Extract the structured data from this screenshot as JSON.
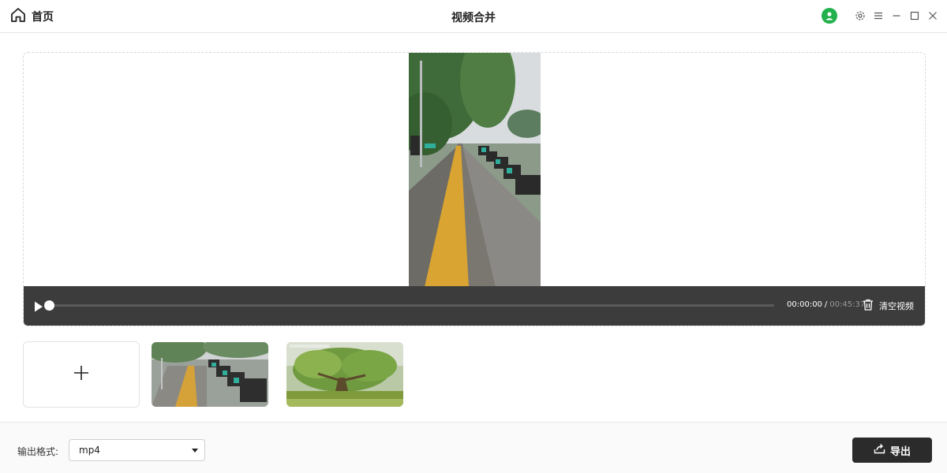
{
  "header": {
    "home_label": "首页",
    "title": "视频合并"
  },
  "player": {
    "current_time": "00:00:00",
    "separator": "/",
    "total_time": "00:45:37",
    "clear_label": "清空视频",
    "progress": 0
  },
  "clips": {
    "add_symbol": "+",
    "items": [
      {
        "name": "rainy-sidewalk-clip"
      },
      {
        "name": "green-tree-clip"
      }
    ]
  },
  "footer": {
    "format_label": "输出格式:",
    "format_value": "mp4",
    "export_label": "导出"
  },
  "colors": {
    "accent_dark": "#2b2b2b",
    "player_bar": "#3c3c3c",
    "avatar_green": "#22b14c"
  },
  "icons": [
    "home-icon",
    "user-avatar-icon",
    "settings-icon",
    "menu-icon",
    "minimize-icon",
    "maximize-icon",
    "close-icon",
    "play-icon",
    "trash-icon",
    "plus-icon",
    "export-icon",
    "chevron-down-icon"
  ]
}
